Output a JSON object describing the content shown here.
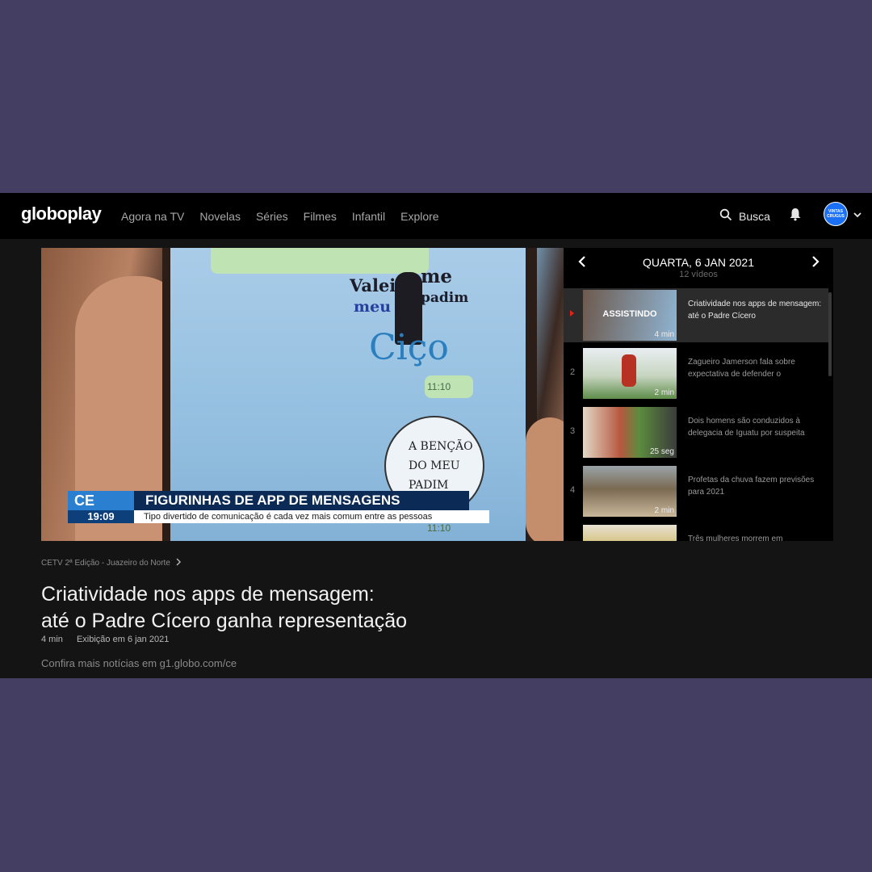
{
  "header": {
    "logo": "globoplay",
    "nav": [
      "Agora na TV",
      "Novelas",
      "Séries",
      "Filmes",
      "Infantil",
      "Explore"
    ],
    "search_label": "Busca",
    "avatar_text": "VINTAS CRUGUS"
  },
  "player": {
    "banner_logo": "CE",
    "banner_time": "19:09",
    "banner_title": "FIGURINHAS DE APP DE MENSAGENS",
    "banner_subtitle": "Tipo divertido de comunicação é cada vez mais comum entre as pessoas",
    "sticker_words": [
      "Valei",
      "me",
      "meu",
      "padim",
      "Ciço"
    ],
    "message_time": "11:10",
    "stamp_text": [
      "A BENÇÃO",
      "DO MEU",
      "PADIM"
    ]
  },
  "playlist": {
    "date": "QUARTA, 6 JAN 2021",
    "count": "12 vídeos",
    "items": [
      {
        "num": "",
        "status": "ASSISTINDO",
        "title": "Criatividade nos apps de mensagem: até o Padre Cícero",
        "duration": "4 min",
        "colors": [
          "#6d5a4e",
          "#8fb4d3"
        ]
      },
      {
        "num": "2",
        "status": "",
        "title": "Zagueiro Jamerson fala sobre expectativa de defender o",
        "duration": "2 min",
        "colors": [
          "#5e8d4a",
          "#9bbf7d"
        ]
      },
      {
        "num": "3",
        "status": "",
        "title": "Dois homens são conduzidos à delegacia de Iguatu por suspeita",
        "duration": "25 seg",
        "colors": [
          "#b7573f",
          "#e2d9c7"
        ]
      },
      {
        "num": "4",
        "status": "",
        "title": "Profetas da chuva fazem previsões para 2021",
        "duration": "2 min",
        "colors": [
          "#7a6a52",
          "#c9b79a"
        ]
      },
      {
        "num": "",
        "status": "",
        "title": "Três mulheres morrem em",
        "duration": "",
        "colors": [
          "#c8b04a",
          "#e8e1d2"
        ]
      }
    ]
  },
  "video": {
    "breadcrumb": "CETV 2ª Edição - Juazeiro do Norte",
    "title_line1": "Criatividade nos apps de mensagem:",
    "title_line2": "até o Padre Cícero ganha representação",
    "duration": "4 min",
    "aired": "Exibição em 6 jan 2021",
    "description": "Confira mais notícias em g1.globo.com/ce"
  }
}
